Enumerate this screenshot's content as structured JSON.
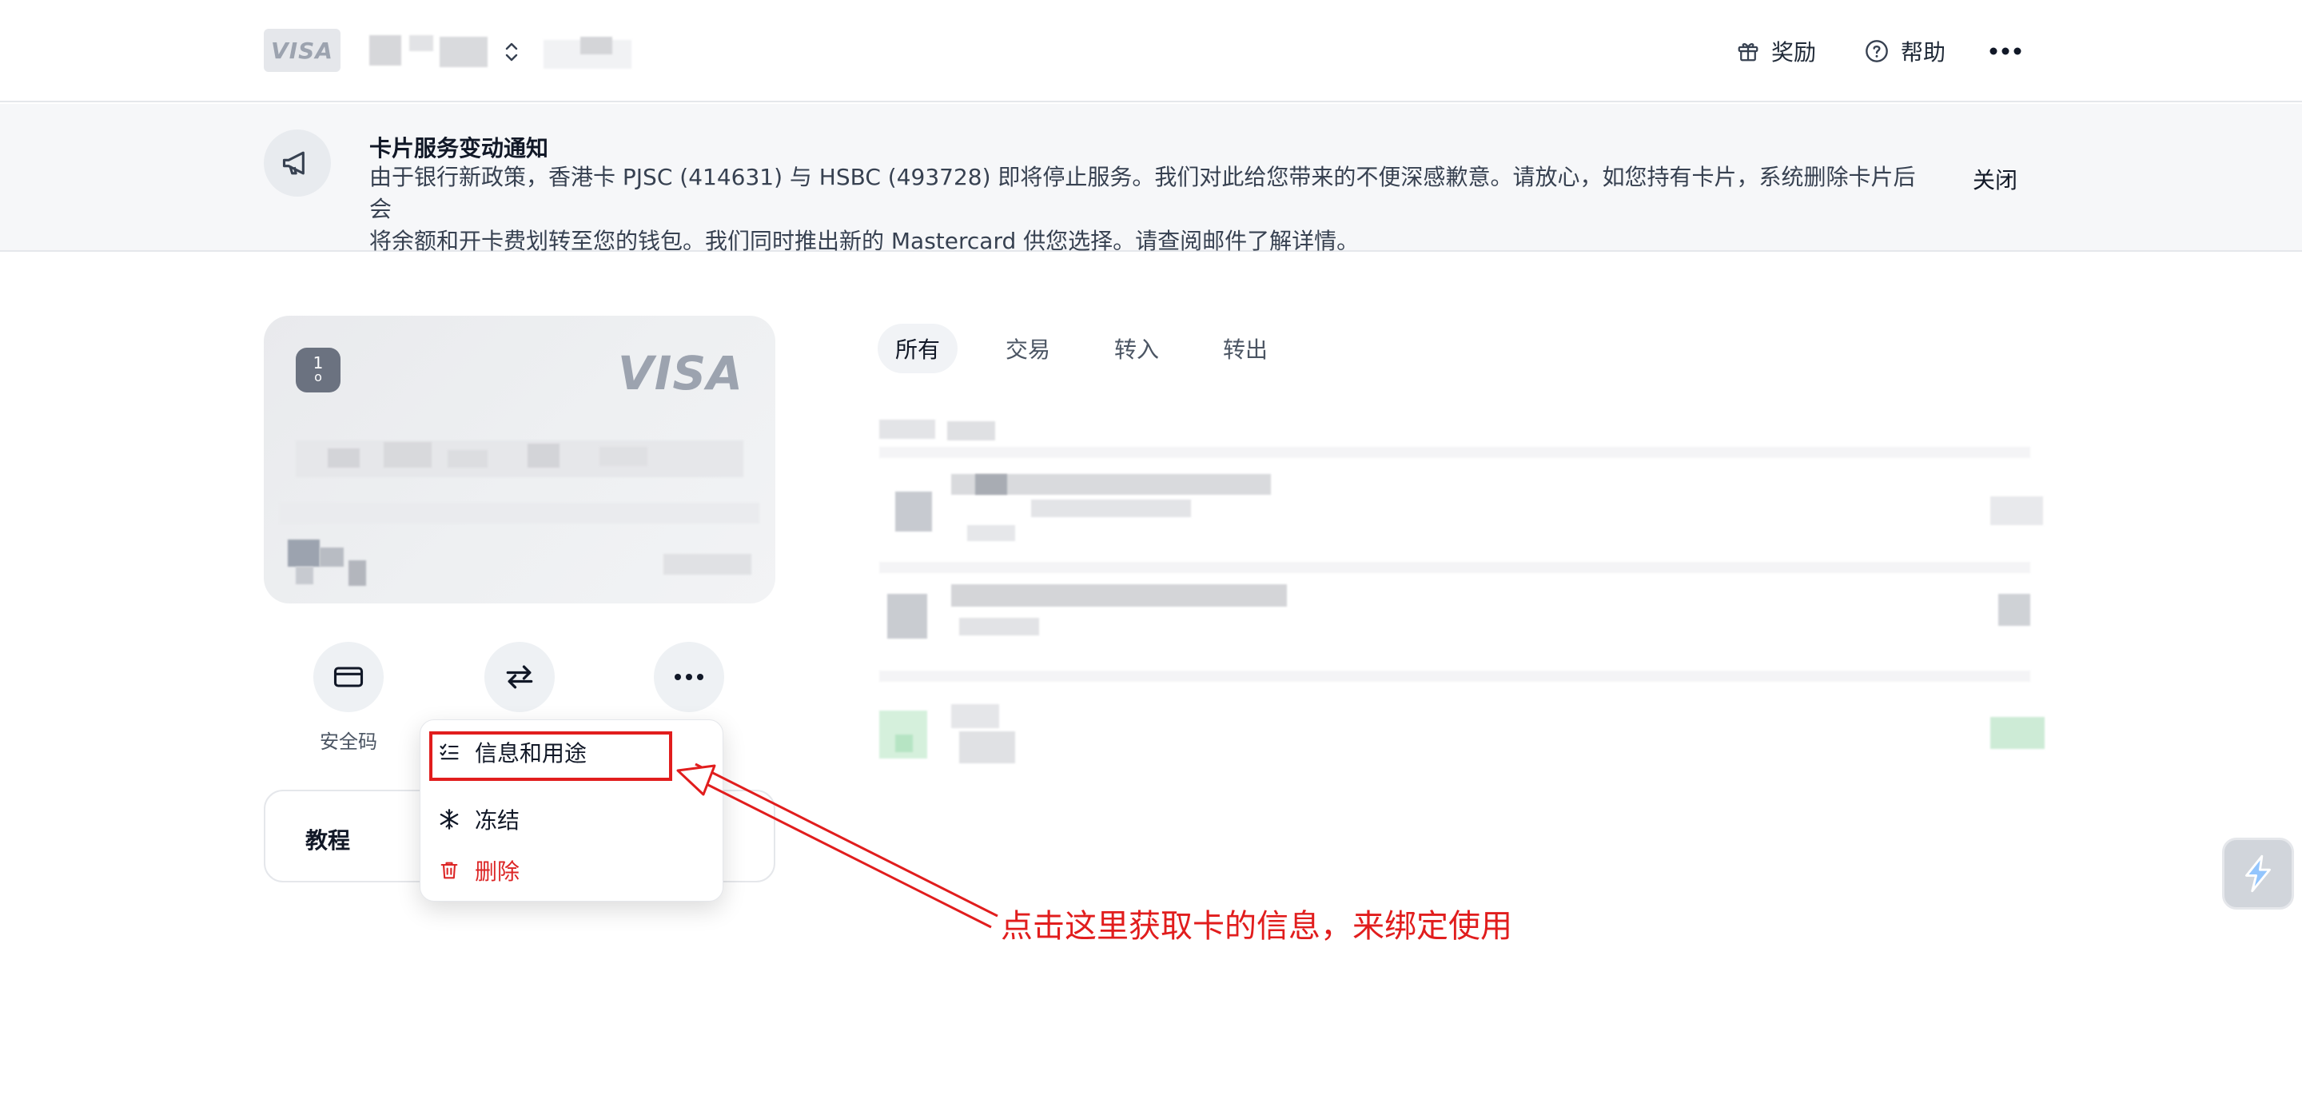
{
  "header": {
    "brand": "VISA",
    "nav": [
      {
        "label": "奖励",
        "icon": "gift-icon"
      },
      {
        "label": "帮助",
        "icon": "help-circle-icon"
      }
    ],
    "more_icon": "more-horizontal-icon"
  },
  "notice": {
    "icon": "megaphone-icon",
    "title": "卡片服务变动通知",
    "line1": "由于银行新政策，香港卡 PJSC (414631) 与 HSBC (493728) 即将停止服务。我们对此给您带来的不便深感歉意。请放心，如您持有卡片，系统删除卡片后会",
    "line2": "将余额和开卡费划转至您的钱包。我们同时推出新的 Mastercard 供您选择。请查阅邮件了解详情。",
    "close_label": "关闭"
  },
  "card": {
    "brand": "VISA",
    "chip_label": "1"
  },
  "actions": [
    {
      "name": "security-code",
      "label": "安全码",
      "icon": "credit-card-icon"
    },
    {
      "name": "transfer",
      "label": "",
      "icon": "swap-arrows-icon"
    },
    {
      "name": "more",
      "label": "",
      "icon": "more-horizontal-icon"
    }
  ],
  "tutorial": {
    "label": "教程"
  },
  "menu": {
    "items": [
      {
        "label": "信息和用途",
        "icon": "list-check-icon"
      },
      {
        "label": "冻结",
        "icon": "snowflake-icon"
      },
      {
        "label": "删除",
        "icon": "trash-icon"
      }
    ]
  },
  "tabs": [
    {
      "label": "所有",
      "active": true
    },
    {
      "label": "交易",
      "active": false
    },
    {
      "label": "转入",
      "active": false
    },
    {
      "label": "转出",
      "active": false
    }
  ],
  "annotation": {
    "text": "点击这里获取卡的信息，来绑定使用"
  },
  "colors": {
    "accent_red": "#e11d1d",
    "danger": "#dc2626"
  }
}
